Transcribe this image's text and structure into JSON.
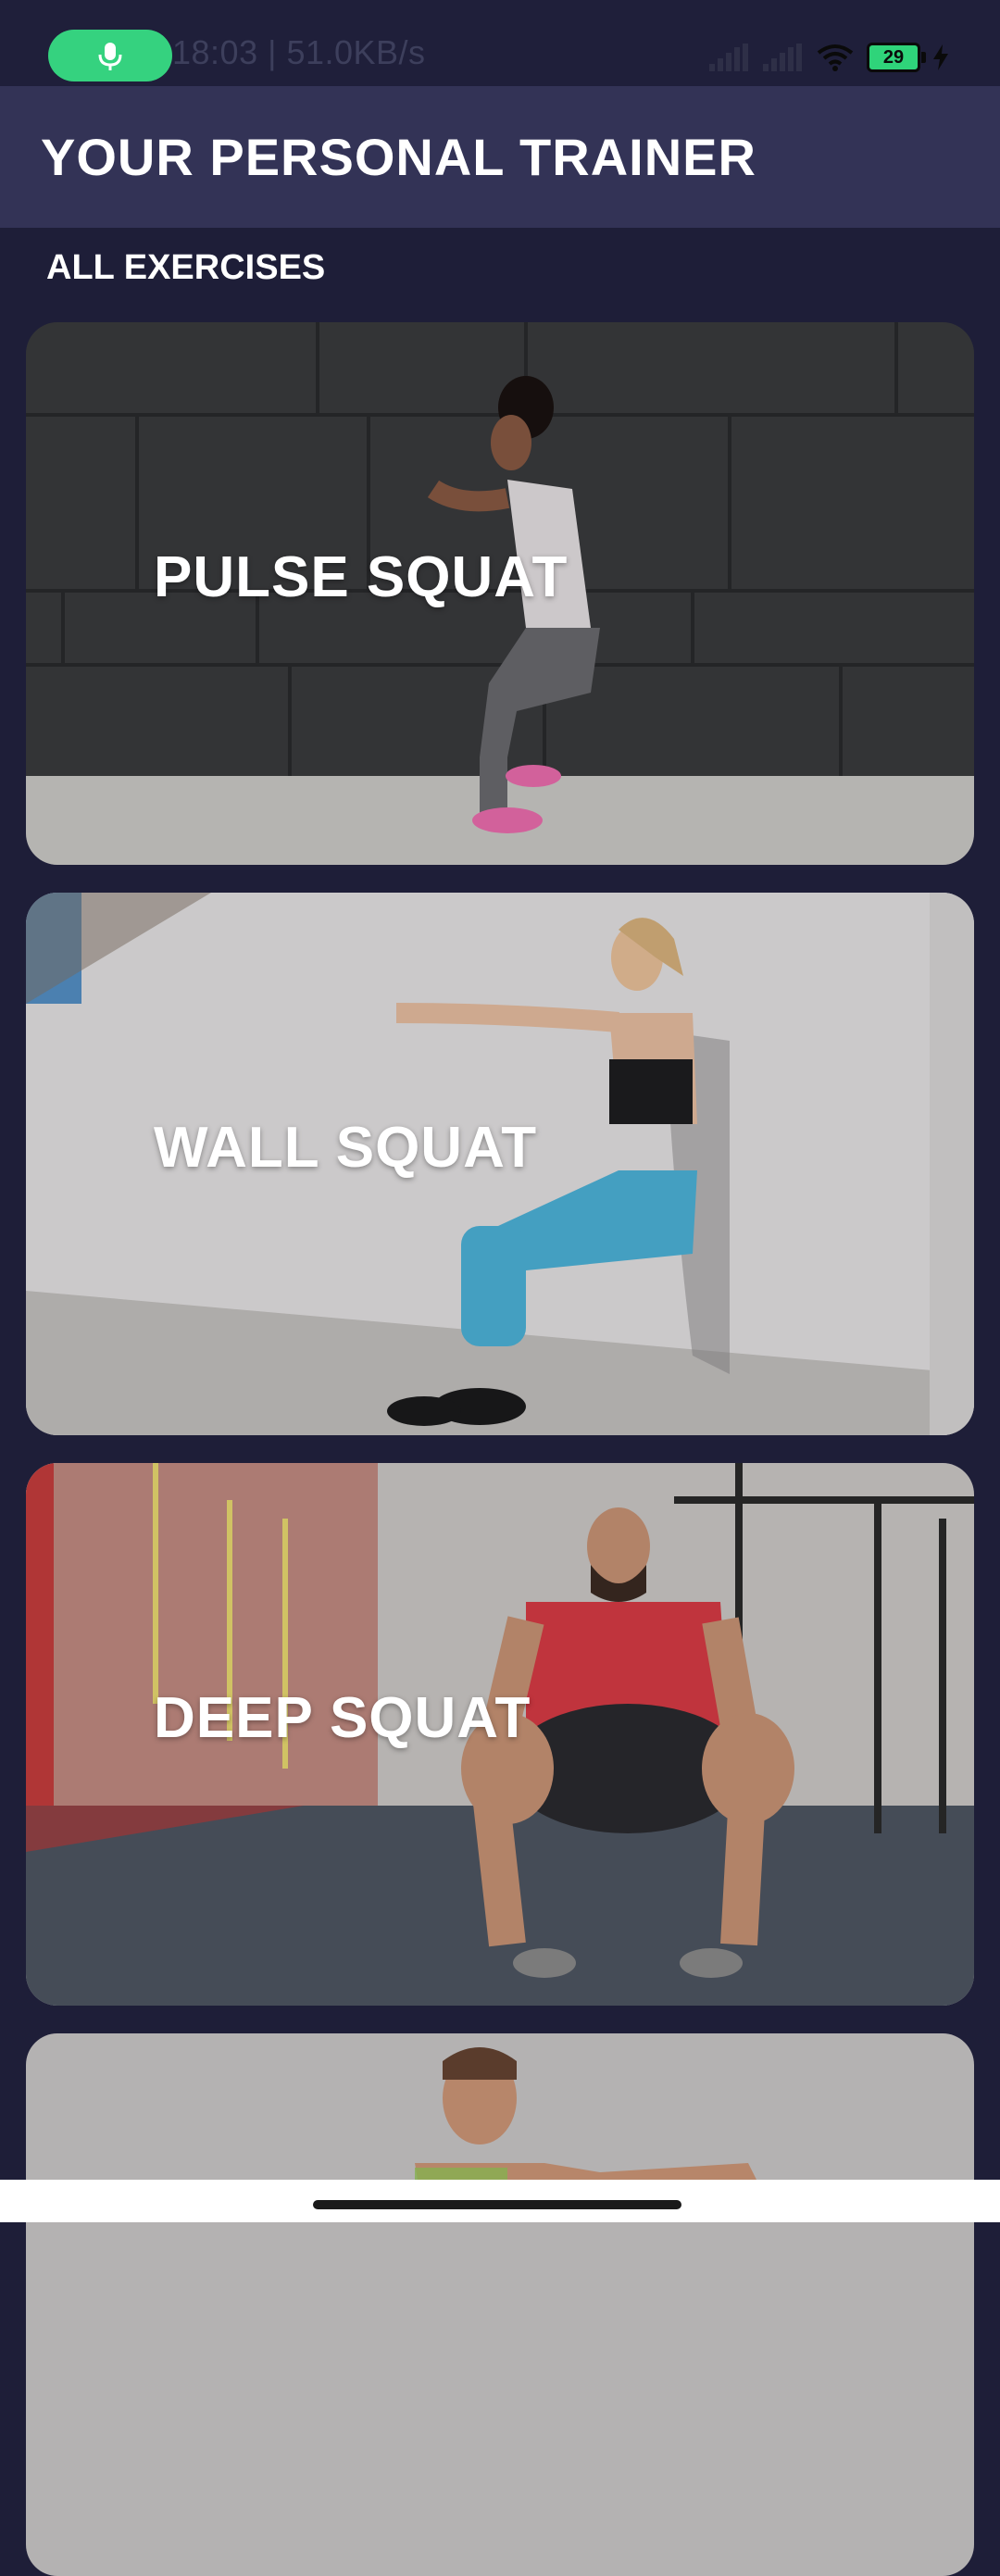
{
  "status_bar": {
    "time_speed": "18:03 | 51.0KB/s",
    "battery_level": "29",
    "icons": [
      "mic-icon",
      "cellular-signal-icon",
      "cellular-signal-icon",
      "wifi-icon",
      "battery-icon",
      "charging-bolt-icon"
    ],
    "mic_pill_color": "#35d27f"
  },
  "app_bar": {
    "title": "YOUR PERSONAL TRAINER",
    "background": "#333356"
  },
  "section": {
    "title": "ALL EXERCISES"
  },
  "exercises": [
    {
      "label": "PULSE SQUAT"
    },
    {
      "label": "WALL SQUAT"
    },
    {
      "label": "DEEP SQUAT"
    },
    {
      "label": ""
    }
  ],
  "theme": {
    "page_background": "#1e1e38",
    "text_color": "#ffffff"
  }
}
